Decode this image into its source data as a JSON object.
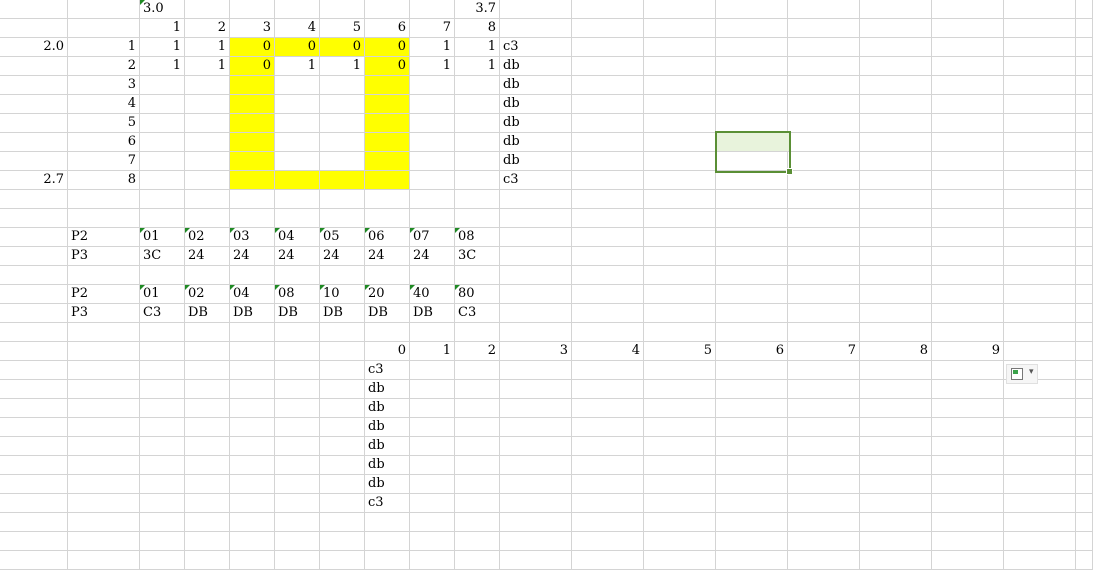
{
  "sheet": {
    "cells": [
      {
        "r": 0,
        "c": 2,
        "v": "3.0",
        "a": "left",
        "mark": true
      },
      {
        "r": 0,
        "c": 9,
        "v": "3.7",
        "a": "right"
      },
      {
        "r": 1,
        "c": 2,
        "v": "1",
        "a": "right"
      },
      {
        "r": 1,
        "c": 3,
        "v": "2",
        "a": "right"
      },
      {
        "r": 1,
        "c": 4,
        "v": "3",
        "a": "right"
      },
      {
        "r": 1,
        "c": 5,
        "v": "4",
        "a": "right"
      },
      {
        "r": 1,
        "c": 6,
        "v": "5",
        "a": "right"
      },
      {
        "r": 1,
        "c": 7,
        "v": "6",
        "a": "right"
      },
      {
        "r": 1,
        "c": 8,
        "v": "7",
        "a": "right"
      },
      {
        "r": 1,
        "c": 9,
        "v": "8",
        "a": "right"
      },
      {
        "r": 2,
        "c": 0,
        "v": "2.0",
        "a": "right"
      },
      {
        "r": 2,
        "c": 1,
        "v": "1",
        "a": "right"
      },
      {
        "r": 2,
        "c": 2,
        "v": "1",
        "a": "right"
      },
      {
        "r": 2,
        "c": 3,
        "v": "1",
        "a": "right"
      },
      {
        "r": 2,
        "c": 4,
        "v": "0",
        "a": "right",
        "fill": true
      },
      {
        "r": 2,
        "c": 5,
        "v": "0",
        "a": "right",
        "fill": true
      },
      {
        "r": 2,
        "c": 6,
        "v": "0",
        "a": "right",
        "fill": true
      },
      {
        "r": 2,
        "c": 7,
        "v": "0",
        "a": "right",
        "fill": true
      },
      {
        "r": 2,
        "c": 8,
        "v": "1",
        "a": "right"
      },
      {
        "r": 2,
        "c": 9,
        "v": "1",
        "a": "right"
      },
      {
        "r": 2,
        "c": 10,
        "v": "c3",
        "a": "left"
      },
      {
        "r": 3,
        "c": 1,
        "v": "2",
        "a": "right"
      },
      {
        "r": 3,
        "c": 2,
        "v": "1",
        "a": "right"
      },
      {
        "r": 3,
        "c": 3,
        "v": "1",
        "a": "right"
      },
      {
        "r": 3,
        "c": 4,
        "v": "0",
        "a": "right",
        "fill": true
      },
      {
        "r": 3,
        "c": 5,
        "v": "1",
        "a": "right"
      },
      {
        "r": 3,
        "c": 6,
        "v": "1",
        "a": "right"
      },
      {
        "r": 3,
        "c": 7,
        "v": "0",
        "a": "right",
        "fill": true
      },
      {
        "r": 3,
        "c": 8,
        "v": "1",
        "a": "right"
      },
      {
        "r": 3,
        "c": 9,
        "v": "1",
        "a": "right"
      },
      {
        "r": 3,
        "c": 10,
        "v": "db",
        "a": "left"
      },
      {
        "r": 4,
        "c": 1,
        "v": "3",
        "a": "right"
      },
      {
        "r": 4,
        "c": 4,
        "v": "",
        "fill": true
      },
      {
        "r": 4,
        "c": 7,
        "v": "",
        "fill": true
      },
      {
        "r": 4,
        "c": 10,
        "v": "db",
        "a": "left"
      },
      {
        "r": 5,
        "c": 1,
        "v": "4",
        "a": "right"
      },
      {
        "r": 5,
        "c": 4,
        "v": "",
        "fill": true
      },
      {
        "r": 5,
        "c": 7,
        "v": "",
        "fill": true
      },
      {
        "r": 5,
        "c": 10,
        "v": "db",
        "a": "left"
      },
      {
        "r": 6,
        "c": 1,
        "v": "5",
        "a": "right"
      },
      {
        "r": 6,
        "c": 4,
        "v": "",
        "fill": true
      },
      {
        "r": 6,
        "c": 7,
        "v": "",
        "fill": true
      },
      {
        "r": 6,
        "c": 10,
        "v": "db",
        "a": "left"
      },
      {
        "r": 7,
        "c": 1,
        "v": "6",
        "a": "right"
      },
      {
        "r": 7,
        "c": 4,
        "v": "",
        "fill": true
      },
      {
        "r": 7,
        "c": 7,
        "v": "",
        "fill": true
      },
      {
        "r": 7,
        "c": 10,
        "v": "db",
        "a": "left"
      },
      {
        "r": 8,
        "c": 1,
        "v": "7",
        "a": "right"
      },
      {
        "r": 8,
        "c": 4,
        "v": "",
        "fill": true
      },
      {
        "r": 8,
        "c": 7,
        "v": "",
        "fill": true
      },
      {
        "r": 8,
        "c": 10,
        "v": "db",
        "a": "left"
      },
      {
        "r": 9,
        "c": 0,
        "v": "2.7",
        "a": "right"
      },
      {
        "r": 9,
        "c": 1,
        "v": "8",
        "a": "right"
      },
      {
        "r": 9,
        "c": 4,
        "v": "",
        "fill": true
      },
      {
        "r": 9,
        "c": 5,
        "v": "",
        "fill": true
      },
      {
        "r": 9,
        "c": 6,
        "v": "",
        "fill": true
      },
      {
        "r": 9,
        "c": 7,
        "v": "",
        "fill": true
      },
      {
        "r": 9,
        "c": 10,
        "v": "c3",
        "a": "left"
      },
      {
        "r": 12,
        "c": 1,
        "v": "P2",
        "a": "left"
      },
      {
        "r": 12,
        "c": 2,
        "v": "01",
        "a": "left",
        "mark": true
      },
      {
        "r": 12,
        "c": 3,
        "v": "02",
        "a": "left",
        "mark": true
      },
      {
        "r": 12,
        "c": 4,
        "v": "03",
        "a": "left",
        "mark": true
      },
      {
        "r": 12,
        "c": 5,
        "v": "04",
        "a": "left",
        "mark": true
      },
      {
        "r": 12,
        "c": 6,
        "v": "05",
        "a": "left",
        "mark": true
      },
      {
        "r": 12,
        "c": 7,
        "v": "06",
        "a": "left",
        "mark": true
      },
      {
        "r": 12,
        "c": 8,
        "v": "07",
        "a": "left",
        "mark": true
      },
      {
        "r": 12,
        "c": 9,
        "v": "08",
        "a": "left",
        "mark": true
      },
      {
        "r": 13,
        "c": 1,
        "v": "P3",
        "a": "left"
      },
      {
        "r": 13,
        "c": 2,
        "v": "3C",
        "a": "left"
      },
      {
        "r": 13,
        "c": 3,
        "v": "24",
        "a": "left"
      },
      {
        "r": 13,
        "c": 4,
        "v": "24",
        "a": "left"
      },
      {
        "r": 13,
        "c": 5,
        "v": "24",
        "a": "left"
      },
      {
        "r": 13,
        "c": 6,
        "v": "24",
        "a": "left"
      },
      {
        "r": 13,
        "c": 7,
        "v": "24",
        "a": "left"
      },
      {
        "r": 13,
        "c": 8,
        "v": "24",
        "a": "left"
      },
      {
        "r": 13,
        "c": 9,
        "v": "3C",
        "a": "left"
      },
      {
        "r": 15,
        "c": 1,
        "v": "P2",
        "a": "left"
      },
      {
        "r": 15,
        "c": 2,
        "v": "01",
        "a": "left",
        "mark": true
      },
      {
        "r": 15,
        "c": 3,
        "v": "02",
        "a": "left",
        "mark": true
      },
      {
        "r": 15,
        "c": 4,
        "v": "04",
        "a": "left",
        "mark": true
      },
      {
        "r": 15,
        "c": 5,
        "v": "08",
        "a": "left",
        "mark": true
      },
      {
        "r": 15,
        "c": 6,
        "v": "10",
        "a": "left",
        "mark": true
      },
      {
        "r": 15,
        "c": 7,
        "v": "20",
        "a": "left",
        "mark": true
      },
      {
        "r": 15,
        "c": 8,
        "v": "40",
        "a": "left",
        "mark": true
      },
      {
        "r": 15,
        "c": 9,
        "v": "80",
        "a": "left",
        "mark": true
      },
      {
        "r": 16,
        "c": 1,
        "v": "P3",
        "a": "left"
      },
      {
        "r": 16,
        "c": 2,
        "v": "C3",
        "a": "left"
      },
      {
        "r": 16,
        "c": 3,
        "v": "DB",
        "a": "left"
      },
      {
        "r": 16,
        "c": 4,
        "v": "DB",
        "a": "left"
      },
      {
        "r": 16,
        "c": 5,
        "v": "DB",
        "a": "left"
      },
      {
        "r": 16,
        "c": 6,
        "v": "DB",
        "a": "left"
      },
      {
        "r": 16,
        "c": 7,
        "v": "DB",
        "a": "left"
      },
      {
        "r": 16,
        "c": 8,
        "v": "DB",
        "a": "left"
      },
      {
        "r": 16,
        "c": 9,
        "v": "C3",
        "a": "left"
      },
      {
        "r": 18,
        "c": 7,
        "v": "0",
        "a": "right"
      },
      {
        "r": 18,
        "c": 8,
        "v": "1",
        "a": "right"
      },
      {
        "r": 18,
        "c": 9,
        "v": "2",
        "a": "right"
      },
      {
        "r": 18,
        "c": 10,
        "v": "3",
        "a": "right"
      },
      {
        "r": 18,
        "c": 11,
        "v": "4",
        "a": "right"
      },
      {
        "r": 18,
        "c": 12,
        "v": "5",
        "a": "right"
      },
      {
        "r": 18,
        "c": 13,
        "v": "6",
        "a": "right"
      },
      {
        "r": 18,
        "c": 14,
        "v": "7",
        "a": "right"
      },
      {
        "r": 18,
        "c": 15,
        "v": "8",
        "a": "right"
      },
      {
        "r": 18,
        "c": 16,
        "v": "9",
        "a": "right"
      },
      {
        "r": 19,
        "c": 7,
        "v": "c3",
        "a": "left"
      },
      {
        "r": 20,
        "c": 7,
        "v": "db",
        "a": "left"
      },
      {
        "r": 21,
        "c": 7,
        "v": "db",
        "a": "left"
      },
      {
        "r": 22,
        "c": 7,
        "v": "db",
        "a": "left"
      },
      {
        "r": 23,
        "c": 7,
        "v": "db",
        "a": "left"
      },
      {
        "r": 24,
        "c": 7,
        "v": "db",
        "a": "left"
      },
      {
        "r": 25,
        "c": 7,
        "v": "db",
        "a": "left"
      },
      {
        "r": 26,
        "c": 7,
        "v": "c3",
        "a": "left"
      }
    ]
  },
  "selection": {
    "label": "selected-cell"
  },
  "paste_options": {
    "icon": "paste-options-icon",
    "caret": "▾"
  }
}
